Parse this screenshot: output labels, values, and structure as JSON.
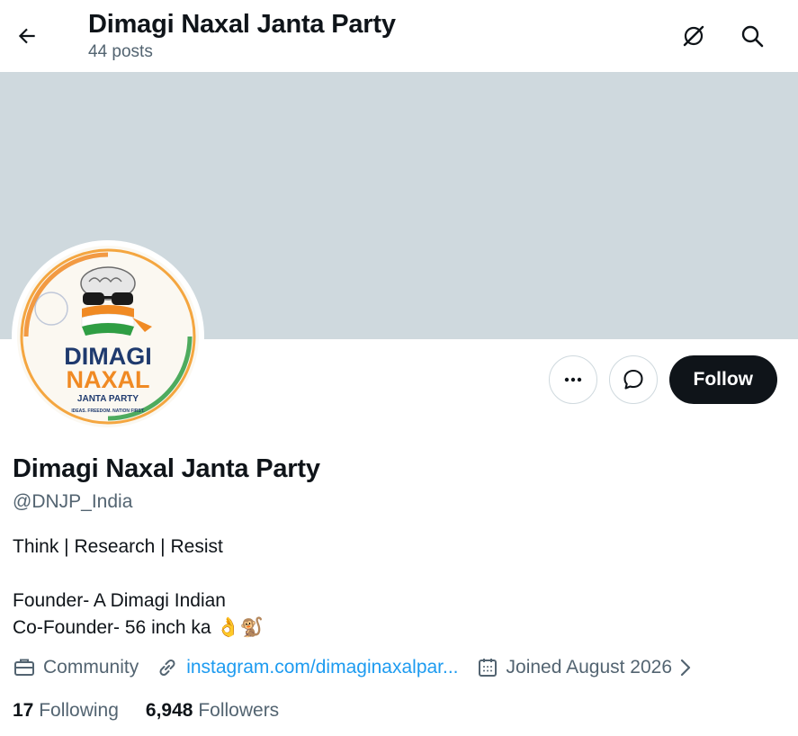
{
  "header": {
    "title": "Dimagi Naxal Janta Party",
    "post_count": "44 posts"
  },
  "icons": {
    "back": "arrow-left-icon",
    "grok": "grok-icon",
    "search": "search-icon",
    "more": "more-dots-icon",
    "message": "message-bubble-icon",
    "category": "briefcase-icon",
    "link": "link-icon",
    "joined": "calendar-icon",
    "expand": "chevron-right-icon"
  },
  "avatar": {
    "logo_line1": "DIMAGI",
    "logo_line2": "NAXAL",
    "logo_line3": "JANTA PARTY",
    "logo_tagline": "IDEAS. FREEDOM. NATION FIRST."
  },
  "actions": {
    "follow_label": "Follow"
  },
  "profile": {
    "name": "Dimagi Naxal Janta Party",
    "handle": "@DNJP_India",
    "bio": "Think | Research | Resist\n\nFounder- A Dimagi Indian\nCo-Founder- 56 inch ka 👌🐒",
    "category": "Community",
    "link": "instagram.com/dimaginaxalpar...",
    "joined": "Joined August 2026"
  },
  "stats": {
    "following_count": "17",
    "following_label": "Following",
    "followers_count": "6,948",
    "followers_label": "Followers"
  },
  "colors": {
    "banner": "#cfd9de",
    "link": "#1d9bf0",
    "secondary_text": "#536471",
    "follow_button": "#0f1419"
  }
}
